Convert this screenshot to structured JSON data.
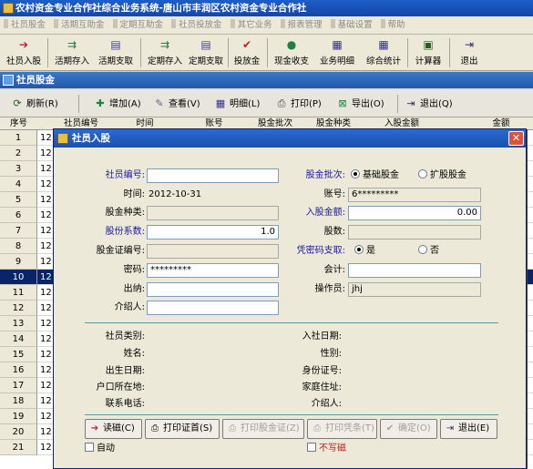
{
  "window_title": "农村资金专业合作社综合业务系统-唐山市丰润区农村资金专业合作社",
  "menu": [
    "社员股金",
    "活期互助金",
    "定期互助金",
    "社员投放金",
    "其它业务",
    "报表管理",
    "基础设置",
    "帮助"
  ],
  "toolbar": [
    {
      "label": "社员入股",
      "icon": "arrow-right-icon"
    },
    {
      "label": "活期存入",
      "icon": "deposit-icon"
    },
    {
      "label": "活期支取",
      "icon": "withdraw-icon"
    },
    {
      "label": "定期存入",
      "icon": "deposit-icon"
    },
    {
      "label": "定期支取",
      "icon": "withdraw-icon"
    },
    {
      "label": "投放金",
      "icon": "check-icon"
    },
    {
      "label": "现金收支",
      "icon": "cash-icon"
    },
    {
      "label": "业务明细",
      "icon": "detail-icon"
    },
    {
      "label": "综合统计",
      "icon": "stats-icon"
    },
    {
      "label": "计算器",
      "icon": "calculator-icon"
    },
    {
      "label": "退出",
      "icon": "exit-icon"
    }
  ],
  "panel_title": "社员股金",
  "subtoolbar": [
    {
      "label": "刷新(R)",
      "icon": "refresh-icon"
    },
    {
      "label": "增加(A)",
      "icon": "add-icon"
    },
    {
      "label": "查看(V)",
      "icon": "view-icon"
    },
    {
      "label": "明细(L)",
      "icon": "detail-icon"
    },
    {
      "label": "打印(P)",
      "icon": "print-icon"
    },
    {
      "label": "导出(O)",
      "icon": "export-icon"
    },
    {
      "label": "退出(Q)",
      "icon": "exit-icon"
    }
  ],
  "grid": {
    "columns": [
      "序号",
      "社员编号",
      "时间",
      "账号",
      "股金批次",
      "股金种类",
      "入股金额",
      "金额"
    ],
    "rows": [
      {
        "no": "1",
        "code": "12"
      },
      {
        "no": "2",
        "code": "12"
      },
      {
        "no": "3",
        "code": "12"
      },
      {
        "no": "4",
        "code": "12"
      },
      {
        "no": "5",
        "code": "12"
      },
      {
        "no": "6",
        "code": "12"
      },
      {
        "no": "7",
        "code": "12"
      },
      {
        "no": "8",
        "code": "12"
      },
      {
        "no": "9",
        "code": "12"
      },
      {
        "no": "10",
        "code": "12"
      },
      {
        "no": "11",
        "code": "12"
      },
      {
        "no": "12",
        "code": "12"
      },
      {
        "no": "13",
        "code": "12"
      },
      {
        "no": "14",
        "code": "12"
      },
      {
        "no": "15",
        "code": "12"
      },
      {
        "no": "16",
        "code": "12"
      },
      {
        "no": "17",
        "code": "12"
      },
      {
        "no": "18",
        "code": "12"
      },
      {
        "no": "19",
        "code": "12"
      },
      {
        "no": "20",
        "code": "12"
      },
      {
        "no": "21",
        "code": "12"
      }
    ],
    "selected_row": "10"
  },
  "dialog": {
    "title": "社员入股",
    "close": "✕",
    "fields": {
      "member_id_label": "社员编号:",
      "member_id_value": "",
      "time_label": "时间:",
      "time_value": "2012-10-31",
      "share_type_label": "股金种类:",
      "share_type_value": "",
      "share_coef_label": "股份系数:",
      "share_coef_value": "1.0",
      "cert_no_label": "股金证编号:",
      "cert_no_value": "",
      "password_label": "密码:",
      "password_value": "*********",
      "cashier_label": "出纳:",
      "cashier_value": "",
      "introducer_label": "介绍人:",
      "introducer_value": "",
      "batch_label": "股金批次:",
      "batch_opt1": "基础股金",
      "batch_opt2": "扩股股金",
      "account_label": "账号:",
      "account_value": "6*********",
      "amount_label": "入股金额:",
      "amount_value": "0.00",
      "shares_label": "股数:",
      "shares_value": "",
      "pwd_withdraw_label": "凭密码支取:",
      "pwd_yes": "是",
      "pwd_no": "否",
      "accountant_label": "会计:",
      "accountant_value": "",
      "operator_label": "操作员:",
      "operator_value": "jhj"
    },
    "info": {
      "member_type": "社员类别:",
      "join_date": "入社日期:",
      "name": "姓名:",
      "gender": "性别:",
      "birth_date": "出生日期:",
      "id_number": "身份证号:",
      "household": "户口所在地:",
      "address": "家庭住址:",
      "phone": "联系电话:",
      "introducer": "介绍人:"
    },
    "buttons": {
      "read_card": "读磁(C)",
      "print_cert_first": "打印证首(S)",
      "print_cert": "打印股金证(Z)",
      "print_voucher": "打印凭条(T)",
      "confirm": "确定(O)",
      "exit": "退出(E)"
    },
    "auto_label": "自动",
    "no_passbook_label": "不写磁"
  }
}
